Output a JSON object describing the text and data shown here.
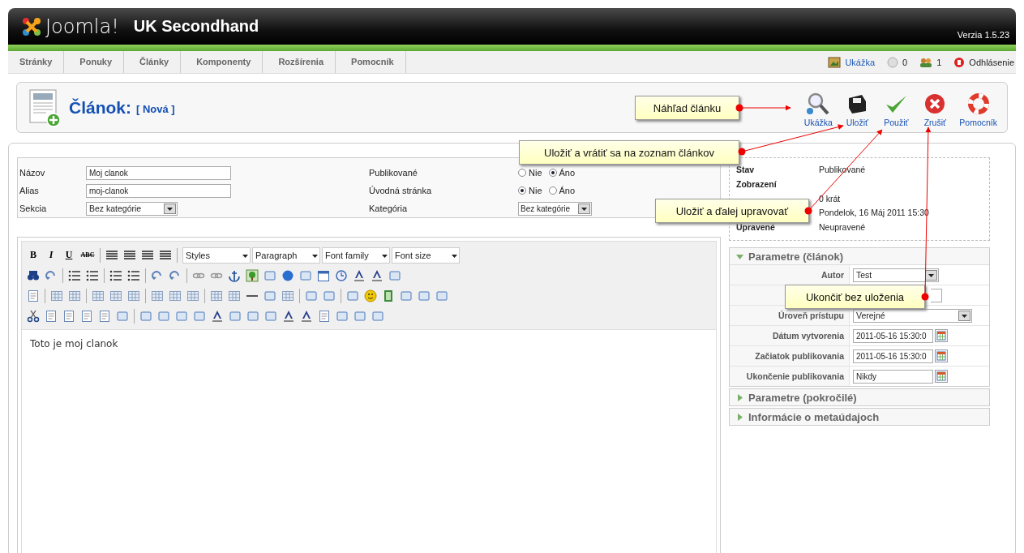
{
  "header": {
    "logo": "Joomla!",
    "site": "UK Secondhand",
    "version": "Verzia 1.5.23"
  },
  "menu": [
    "Stránky",
    "Ponuky",
    "Články",
    "Komponenty",
    "Rozšírenia",
    "Pomocník"
  ],
  "status": {
    "preview": "Ukážka",
    "messages": "0",
    "users": "1",
    "logout": "Odhlásenie"
  },
  "page": {
    "title": "Článok:",
    "subtitle": "[ Nová ]"
  },
  "toolbar": [
    {
      "label": "Ukážka",
      "kind": "preview"
    },
    {
      "label": "Uložiť",
      "kind": "save"
    },
    {
      "label": "Použiť",
      "kind": "apply"
    },
    {
      "label": "Zrušiť",
      "kind": "cancel"
    },
    {
      "label": "Pomocník",
      "kind": "help"
    }
  ],
  "form": {
    "left": [
      {
        "label": "Názov",
        "kind": "input",
        "value": "Moj clanok"
      },
      {
        "label": "Alias",
        "kind": "input",
        "value": "moj-clanok"
      },
      {
        "label": "Sekcia",
        "kind": "select",
        "value": "Bez kategórie"
      }
    ],
    "right": [
      {
        "label": "Publikované",
        "kind": "radio",
        "options": [
          {
            "label": "Nie",
            "selected": false
          },
          {
            "label": "Áno",
            "selected": true
          }
        ]
      },
      {
        "label": "Úvodná stránka",
        "kind": "radio",
        "options": [
          {
            "label": "Nie",
            "selected": true
          },
          {
            "label": "Áno",
            "selected": false
          }
        ]
      },
      {
        "label": "Kategória",
        "kind": "select",
        "value": "Bez kategórie"
      }
    ]
  },
  "editor": {
    "format_buttons": [
      "B",
      "I",
      "U",
      "ABC"
    ],
    "dropdowns": [
      "Styles",
      "Paragraph",
      "Font family",
      "Font size"
    ],
    "content": "Toto je moj clanok"
  },
  "info": [
    {
      "label": "Stav",
      "value": "Publikované"
    },
    {
      "label": "Zobrazení"
    },
    {
      "value": "0 krát"
    },
    {
      "value": "Pondelok, 16 Máj 2011 15:30"
    },
    {
      "label": "Upravené",
      "value": "Neupravené"
    }
  ],
  "params": [
    {
      "title": "Parametre (článok)",
      "expanded": true,
      "rows": [
        {
          "label": "Autor",
          "kind": "select",
          "value": "Test"
        },
        {
          "kind": "input"
        },
        {
          "label": "Úroveň prístupu",
          "kind": "select",
          "value": "Verejné"
        },
        {
          "label": "Dátum vytvorenia",
          "kind": "date",
          "value": "2011-05-16 15:30:0"
        },
        {
          "label": "Začiatok publikovania",
          "kind": "date",
          "value": "2011-05-16 15:30:0"
        },
        {
          "label": "Ukončenie publikovania",
          "kind": "date",
          "value": "Nikdy"
        }
      ]
    },
    {
      "title": "Parametre (pokročilé)",
      "expanded": false
    },
    {
      "title": "Informácie o metaúdajoch",
      "expanded": false
    }
  ],
  "callouts": [
    {
      "text": "Náhľad článku"
    },
    {
      "text": "Uložiť a vrátiť sa na zoznam článkov"
    },
    {
      "text": "Uložiť a ďalej upravovať"
    },
    {
      "text": "Ukončiť bez uloženia"
    }
  ]
}
